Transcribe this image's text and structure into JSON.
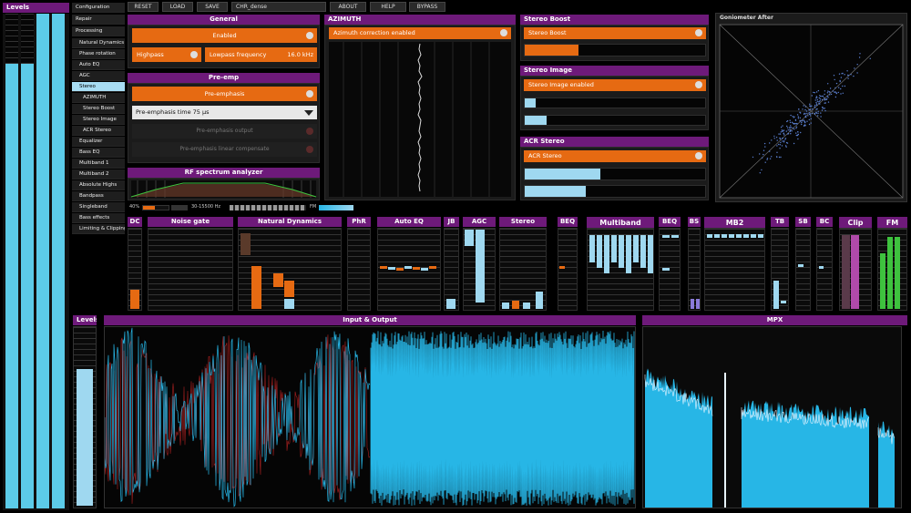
{
  "levels_left": {
    "title": "Levels"
  },
  "nav": {
    "items": [
      {
        "label": "Configuration",
        "level": 0
      },
      {
        "label": "Repair",
        "level": 0
      },
      {
        "label": "Processing",
        "level": 0
      },
      {
        "label": "Natural Dynamics",
        "level": 1
      },
      {
        "label": "Phase rotation",
        "level": 1
      },
      {
        "label": "Auto EQ",
        "level": 1
      },
      {
        "label": "AGC",
        "level": 1
      },
      {
        "label": "Stereo",
        "level": 1,
        "active": true
      },
      {
        "label": "AZIMUTH",
        "level": 2
      },
      {
        "label": "Stereo Boost",
        "level": 2
      },
      {
        "label": "Stereo Image",
        "level": 2
      },
      {
        "label": "ACR Stereo",
        "level": 2
      },
      {
        "label": "Equalizer",
        "level": 1
      },
      {
        "label": "Bass EQ",
        "level": 1
      },
      {
        "label": "Multiband 1",
        "level": 1
      },
      {
        "label": "Multiband 2",
        "level": 1
      },
      {
        "label": "Absolute Highs",
        "level": 1
      },
      {
        "label": "Bandpass",
        "level": 1
      },
      {
        "label": "Singleband",
        "level": 1
      },
      {
        "label": "Bass effects",
        "level": 1
      },
      {
        "label": "Limiting & Clipping",
        "level": 1
      }
    ]
  },
  "toolbar": {
    "reset": "RESET",
    "load": "LOAD",
    "save": "SAVE",
    "preset": "CHR_dense",
    "about": "ABOUT",
    "help": "HELP",
    "bypass": "BYPASS"
  },
  "general": {
    "title": "General",
    "enabled": "Enabled",
    "phase_label": "Highpass",
    "freq_label": "Lowpass frequency",
    "freq_value": "16.0 kHz"
  },
  "preemph": {
    "title": "Pre-emp",
    "toggle": "Pre-emphasis",
    "select_value": "Pre-emphasis time 75 µs",
    "out_label": "Pre-emphasis output",
    "lin_label": "Pre-emphasis linear compensate"
  },
  "rf": {
    "title": "RF spectrum analyzer",
    "low": "40%",
    "range": "30-15500 Hz",
    "fm": "FM"
  },
  "azimuth": {
    "title": "AZIMUTH",
    "toggle": "Azimuth correction enabled"
  },
  "stereo_boost": {
    "title": "Stereo Boost",
    "toggle": "Stereo Boost",
    "level": 0.3
  },
  "stereo_image": {
    "title": "Stereo Image",
    "toggle": "Stereo Image enabled",
    "level1": 0.06,
    "level2": 0.12
  },
  "acr_stereo": {
    "title": "ACR Stereo",
    "toggle": "ACR Stereo",
    "level1": 0.42,
    "level2": 0.34
  },
  "goniometer": {
    "title": "Goniometer After"
  },
  "meters": {
    "dc": "DC",
    "noise_gate": "Noise gate",
    "natural_dynamics": "Natural Dynamics",
    "phr": "PhR",
    "auto_eq": "Auto EQ",
    "jb": "JB",
    "agc": "AGC",
    "stereo": "Stereo",
    "beq": "BEQ",
    "multiband": "Multiband",
    "beq2": "BEQ",
    "bs": "BS",
    "mb2": "MB2",
    "tb": "TB",
    "sb": "SB",
    "bc": "BC",
    "clip": "Clip",
    "fm": "FM"
  },
  "levels_small": {
    "title": "Levels"
  },
  "io": {
    "title": "Input & Output"
  },
  "mpx": {
    "title": "MPX"
  },
  "colors": {
    "orange": "#e66a12",
    "purple": "#6e1a7a",
    "light_blue": "#9fd8f0",
    "cyan": "#27b6e6"
  }
}
